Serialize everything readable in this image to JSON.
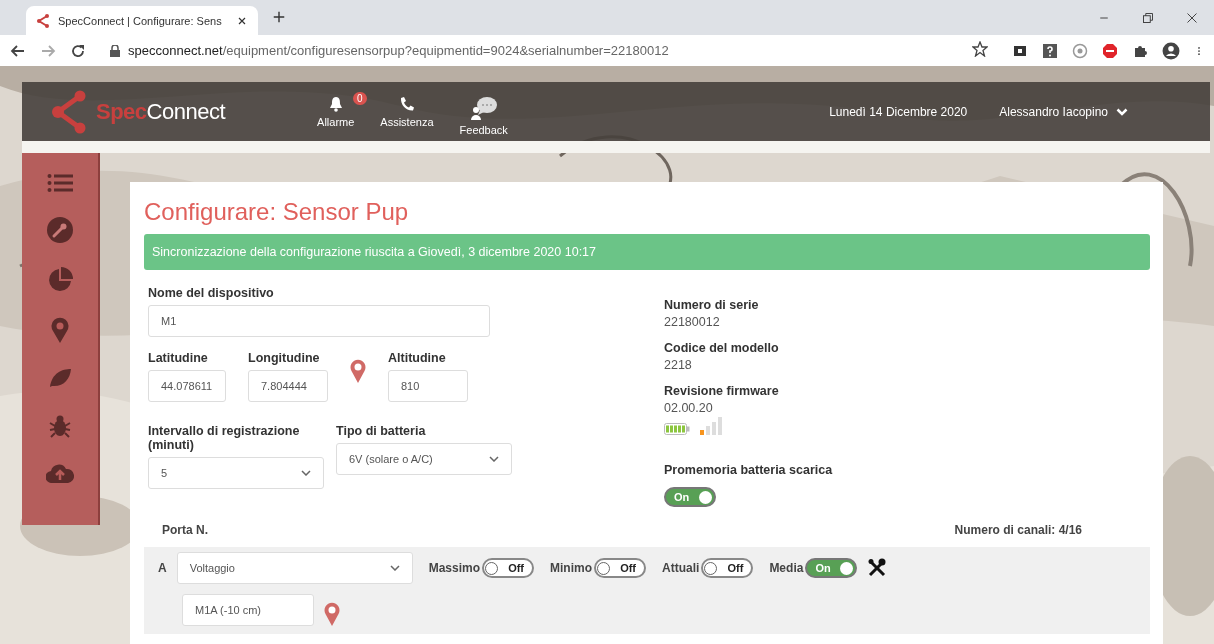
{
  "browser": {
    "tab_title": "SpecConnect | Configurare: Sens",
    "url_host": "specconnect.net",
    "url_path": "/equipment/configuresensorpup?equipmentid=9024&serialnumber=22180012"
  },
  "header": {
    "logo_spec": "Spec",
    "logo_connect": "Connect",
    "nav": [
      {
        "kind": "bell",
        "label": "Allarme",
        "badge": "0"
      },
      {
        "kind": "phone",
        "label": "Assistenza"
      },
      {
        "kind": "chat",
        "label": "Feedback"
      }
    ],
    "date": "Lunedì 14 Dicembre 2020",
    "user": "Alessandro Iacopino"
  },
  "sidebar": {
    "items": [
      {
        "kind": "list"
      },
      {
        "kind": "wrench"
      },
      {
        "kind": "pie"
      },
      {
        "kind": "pin"
      },
      {
        "kind": "leaf"
      },
      {
        "kind": "bug"
      },
      {
        "kind": "upload"
      }
    ]
  },
  "title": "Configurare: Sensor Pup",
  "alert": "Sincronizzazione della configurazione riuscita a Giovedì, 3 dicembre 2020 10:17",
  "form": {
    "device_name": {
      "label": "Nome del dispositivo",
      "value": "M1"
    },
    "latitude": {
      "label": "Latitudine",
      "value": "44.078611"
    },
    "longitude": {
      "label": "Longitudine",
      "value": "7.804444"
    },
    "altitude": {
      "label": "Altitudine",
      "value": "810"
    },
    "interval": {
      "label": "Intervallo di registrazione (minuti)",
      "value": "5"
    },
    "battery_type": {
      "label": "Tipo di batteria",
      "value": "6V (solare o A/C)"
    }
  },
  "info": [
    {
      "label": "Numero di serie",
      "value": "22180012"
    },
    {
      "label": "Codice del modello",
      "value": "2218"
    },
    {
      "label": "Revisione firmware",
      "value": "02.00.20"
    }
  ],
  "low_battery_reminder": {
    "label": "Promemoria batteria scarica",
    "on": true,
    "text": "On"
  },
  "ports": {
    "header": "Porta N.",
    "channel_count": "Numero di canali: 4/16",
    "rows": [
      {
        "port": "A",
        "sensor": "Voltaggio",
        "name": "M1A (-10 cm)",
        "toggles": [
          {
            "label": "Massimo",
            "on": false,
            "text": "Off"
          },
          {
            "label": "Minimo",
            "on": false,
            "text": "Off"
          },
          {
            "label": "Attuali",
            "on": false,
            "text": "Off"
          },
          {
            "label": "Media",
            "on": true,
            "text": "On"
          }
        ]
      }
    ]
  }
}
